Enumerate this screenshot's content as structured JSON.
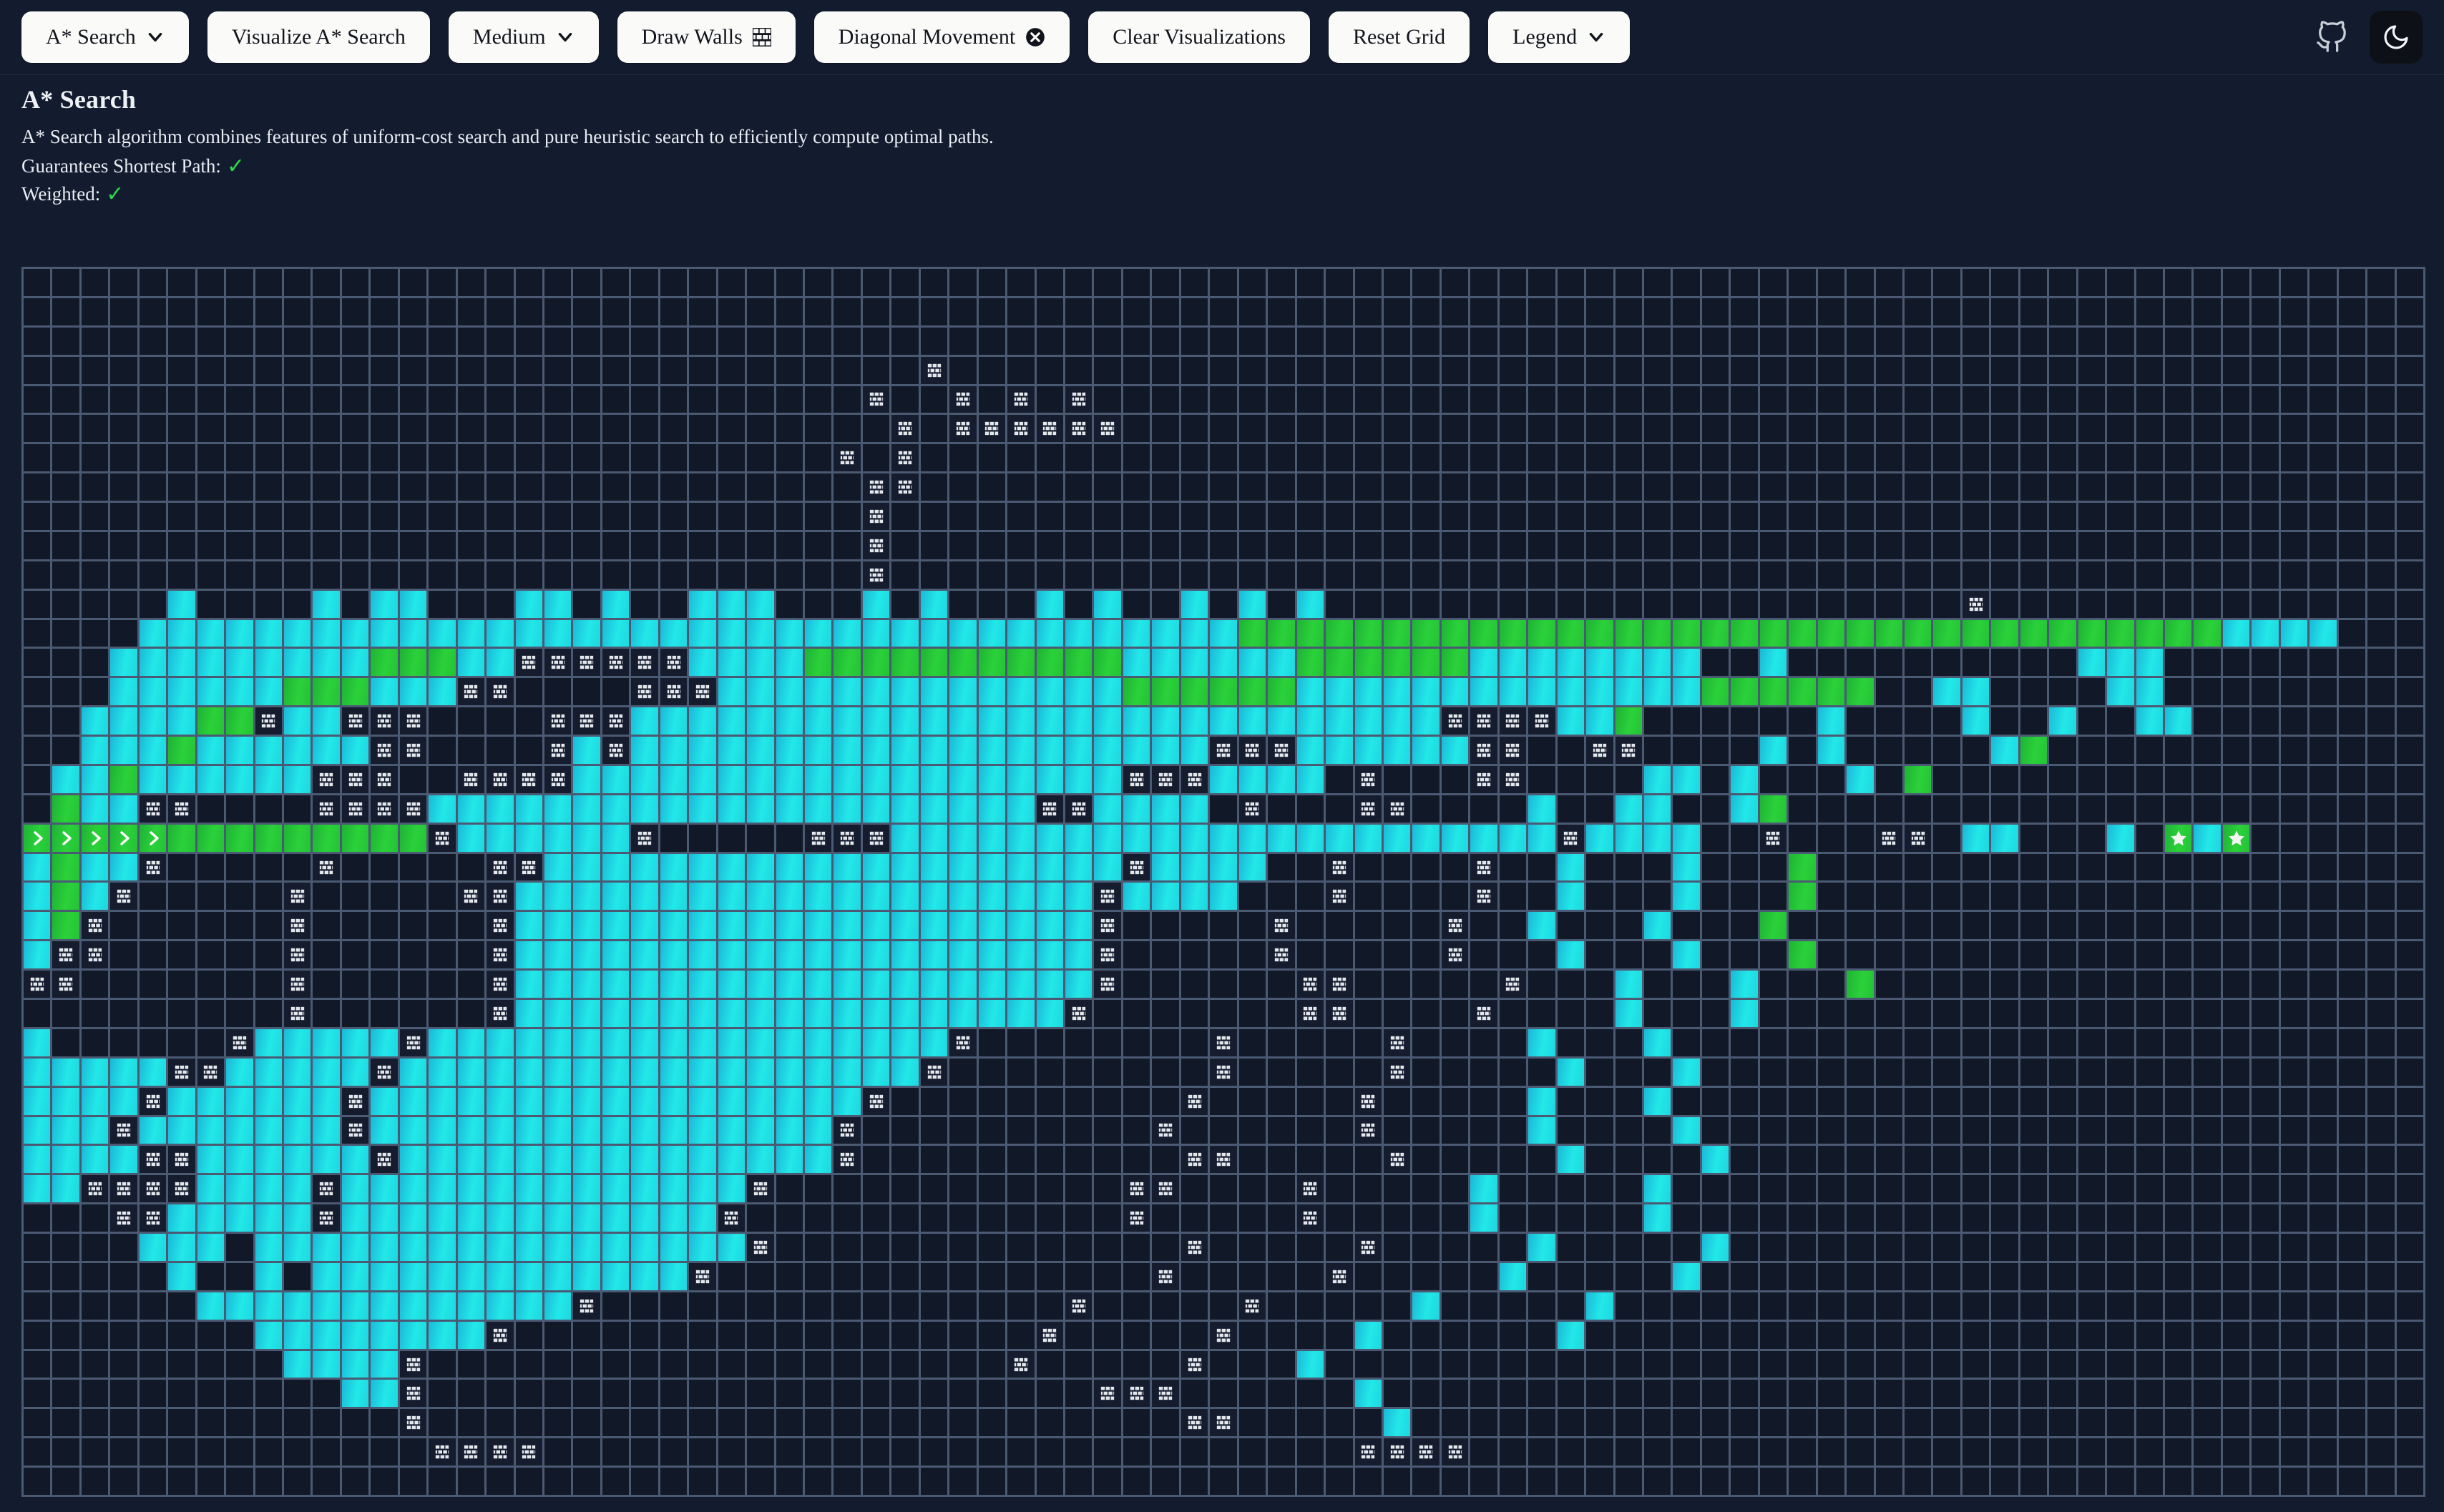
{
  "toolbar": {
    "buttons": [
      {
        "label": "A* Search",
        "icon": "chevron-down-icon",
        "name": "algorithm-select"
      },
      {
        "label": "Visualize A* Search",
        "icon": "none",
        "name": "visualize-button"
      },
      {
        "label": "Medium",
        "icon": "chevron-down-icon",
        "name": "speed-select"
      },
      {
        "label": "Draw Walls",
        "icon": "brick-icon",
        "name": "draw-walls-button"
      },
      {
        "label": "Diagonal Movement",
        "icon": "x-circle-icon",
        "name": "diagonal-movement-toggle"
      },
      {
        "label": "Clear Visualizations",
        "icon": "none",
        "name": "clear-visualizations-button"
      },
      {
        "label": "Reset Grid",
        "icon": "none",
        "name": "reset-grid-button"
      },
      {
        "label": "Legend",
        "icon": "chevron-down-icon",
        "name": "legend-dropdown"
      }
    ],
    "github_label": "github-icon",
    "theme_label": "moon-icon"
  },
  "info": {
    "title": "A* Search",
    "description": "A* Search algorithm combines features of uniform-cost search and pure heuristic search to efficiently compute optimal paths.",
    "shortest_path_label": "Guarantees Shortest Path:",
    "shortest_path_value": "✓",
    "weighted_label": "Weighted:",
    "weighted_value": "✓"
  },
  "colors": {
    "background": "#131c2e",
    "grid_line": "#4b5a73",
    "cell_empty": "#111827",
    "visited": "#22e8e8",
    "visited_dark": "#1bb8d8",
    "path": "#2bd13a",
    "wall": "#141c2e",
    "brick": "#e4e7ec",
    "check": "#2fd44c",
    "button_bg": "#fafaf9",
    "button_text": "#12141c"
  },
  "grid": {
    "cols": 83,
    "rows": 42,
    "start": {
      "row": 19,
      "col": 4,
      "icon": "chevron-right-icon"
    },
    "end": {
      "row": 19,
      "col": 74,
      "icon": "star-icon"
    },
    "legend_codes": {
      "e": "empty",
      "v": "visited",
      "p": "path",
      "w": "wall",
      "s": "start",
      "t": "end"
    },
    "rows_rle": [
      "83e",
      "83e",
      "83e",
      "31e,1w,51e",
      "29e,1w,2e,1w,1e,1w,1e,1w,47e",
      "30e,1w,1e,1w,1w,1w,1w,1w,1w,46e",
      "28e,1w,1e,1w,53e",
      "29e,2w,52e",
      "29e,1w,53e",
      "29e,1w,53e",
      "29e,1w,53e",
      "5e,1v,4e,1v,1e,2v,3e,1v,1v,1e,1v,2e,3v,3e,1v,1e,1v,3e,1v,1e,1v,2e,1v,1e,1v,1e,1v,22e,1w,24e",
      "4e,38v,1p,1p,1p,1p,1p,1p,1p,1p,1p,1p,1p,1p,1p,1p,1p,1p,1p,1p,1p,1p,1p,1p,1p,1p,1p,1p,1p,1p,1p,1p,1p,1p,1p,1p,4v,2e,5e",
      "3e,9v,1p,2p,2v,1w,1w,1w,1w,1w,1w,4v,4p,1p,1p,1p,1p,1p,1p,1p,6v,1p,1p,1p,1p,1p,1p,8v,2e,1v,10e,3v,2e",
      "3e,6v,3p,3v,1w,1w,4e,3w,1v,4v,1v,8v,3p,3p,2v,12v,3p,3p,2e,2v,4e,2v,3e",
      "2e,4v,2p,1w,2v,3w,4e,3w,1v,5v,8v,12v,2v,1w,1w,1w,1w,2v,1p,6e,1v,4e,1v,2e,1v,2e,2v,1e",
      "2e,3v,1p,2v,4v,2w,4e,1w,1v,1w,6v,8v,6v,3w,4v,2v,1w,1w,2e,1w,1w,4e,1v,1e,1v,5e,1v,1p,1e",
      "1e,2v,1p,6v,3w,2e,1w,3w,1v,6v,6v,6v,3w,4v,1e,1w,3e,2w,4e,2v,1e,1v,3e,1v,1e,1p,1e",
      "1e,1p,2v,2w,4e,1w,3w,1v,7v,5v,8v,2w,4v,1e,1w,3e,1w,1w,4e,1v,2e,2v,2e,1v,1p,1e",
      "4s,1p,1p,1p,1p,1p,1p,1p,1p,1p,1p,1w,6v,1w,5e,1w,2w,1v,8v,8v,6v,1w,4v,2e,1w,3e,1w,1w,1e,2v,3e,1v,2e,1v,1t,1e",
      "1v,1p,2v,1w,5e,1w,5e,2w,6v,8v,6v,1w,4v,2e,1w,4e,1w,2e,1v,3e,1v,3e,1p,1e",
      "1v,1p,1v,1w,5e,1w,5e,1w,1w,6v,8v,6v,1w,4v,3e,1w,4e,1w,2e,1v,3e,1v,3e,1p,1e",
      "1v,1p,1w,6e,1w,6e,1w,6v,8v,6v,1w,5e,1w,5e,1w,2e,1v,3e,1v,3e,1p,1e",
      "1v,1w,1w,6e,1w,6e,1w,6v,8v,6v,1w,5e,1w,5e,1w,3e,1v,3e,1v,3e,1p,1e",
      "1w,1w,7e,1w,6e,1w,6v,8v,6v,1w,6e,2w,5e,1w,3e,1v,3e,1v,3e,1p,1e",
      "9e,1w,6e,1w,6v,8v,5v,1w,7e,2w,4e,1w,4e,1v,3e,1v,4e,1e",
      "1v,6e,1w,1v,4v,1w,5v,8v,5v,1w,8e,1w,5e,1w,4e,1v,3e,1v,4e,1e",
      "5v,2w,5v,1w,5v,8v,5v,1w,9e,1w,5e,1w,5e,1v,3e,1v,4e,1e",
      "4v,1w,6v,1w,5v,8v,4v,1w,10e,1w,5e,1w,5e,1v,3e,1v,4e,1e",
      "3v,1w,7v,1w,4v,8v,4v,1w,10e,1w,6e,1w,5e,1v,4e,1v,3e,1e",
      "4v,2w,6v,1w,4v,7v,4v,1w,11e,2w,5e,1w,5e,1v,4e,1v,3e,1e",
      "2v,1w,1w,1w,1w,4v,1w,3v,7v,4v,1w,12e,2w,4e,1w,5e,1v,5e,1v,2e,1e",
      "3e,1w,1w,5v,1w,3v,6v,4v,1w,13e,1w,5e,1w,5e,1v,5e,1v,2e,1e",
      "4e,3v,1e,5v,3v,6v,3v,1w,14e,1w,5e,1w,5e,1v,5e,1v,2e,1e",
      "5e,1v,2e,1v,1e,3v,2v,6v,2v,1w,15e,1w,5e,1w,5e,1v,5e,1v,2e,1e",
      "6e,5v,2v,5v,1v,1w,16e,1w,5e,1w,5e,1v,5e,1v,2e,1e",
      "8e,3v,3v,2v,1w,18e,1w,5e,1w,4e,1v,6e,1v,1e,1e",
      "9e,4v,1w,20e,1w,5e,1w,3e,1v,7e,1e",
      "11e,2v,1w,23e,3w,6e,1v,8e,1e",
      "13e,1w,26e,2w,5e,1v,9e,1e",
      "14e,4w,28e,4w,10e",
      "83e"
    ],
    "note": "rle runs: count+code; rows render left to right, truncated/padded to cols"
  }
}
